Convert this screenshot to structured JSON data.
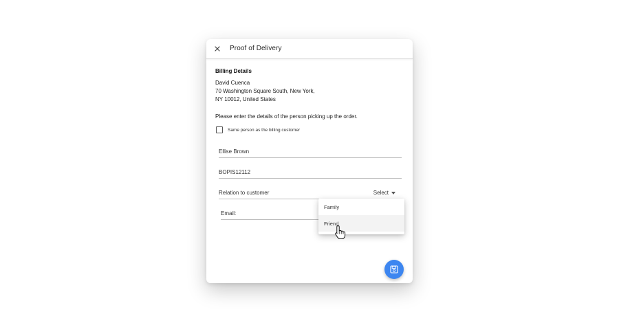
{
  "dialog": {
    "title": "Proof of Delivery",
    "close_icon": "close-icon"
  },
  "billing": {
    "heading": "Billing Details",
    "name": "David Cuenca",
    "address_line_1": "70 Washington Square South, New York,",
    "address_line_2": "NY 10012, United States"
  },
  "pickup": {
    "instructions": "Please enter the details of the person picking up the order.",
    "same_person_label": "Same person as the billing customer",
    "same_person_checked": false,
    "name_value": "Ellise Brown",
    "order_value": "BOPIS12112",
    "relation_label": "Relation to customer",
    "relation_select": "Select",
    "email_label": "Email:"
  },
  "relation_dropdown": {
    "options": [
      "Family",
      "Friend"
    ],
    "hovered": "Friend"
  },
  "fab": {
    "icon": "save-icon",
    "color": "#3d86f0"
  },
  "cursor": {
    "icon": "hand-pointer-icon"
  }
}
